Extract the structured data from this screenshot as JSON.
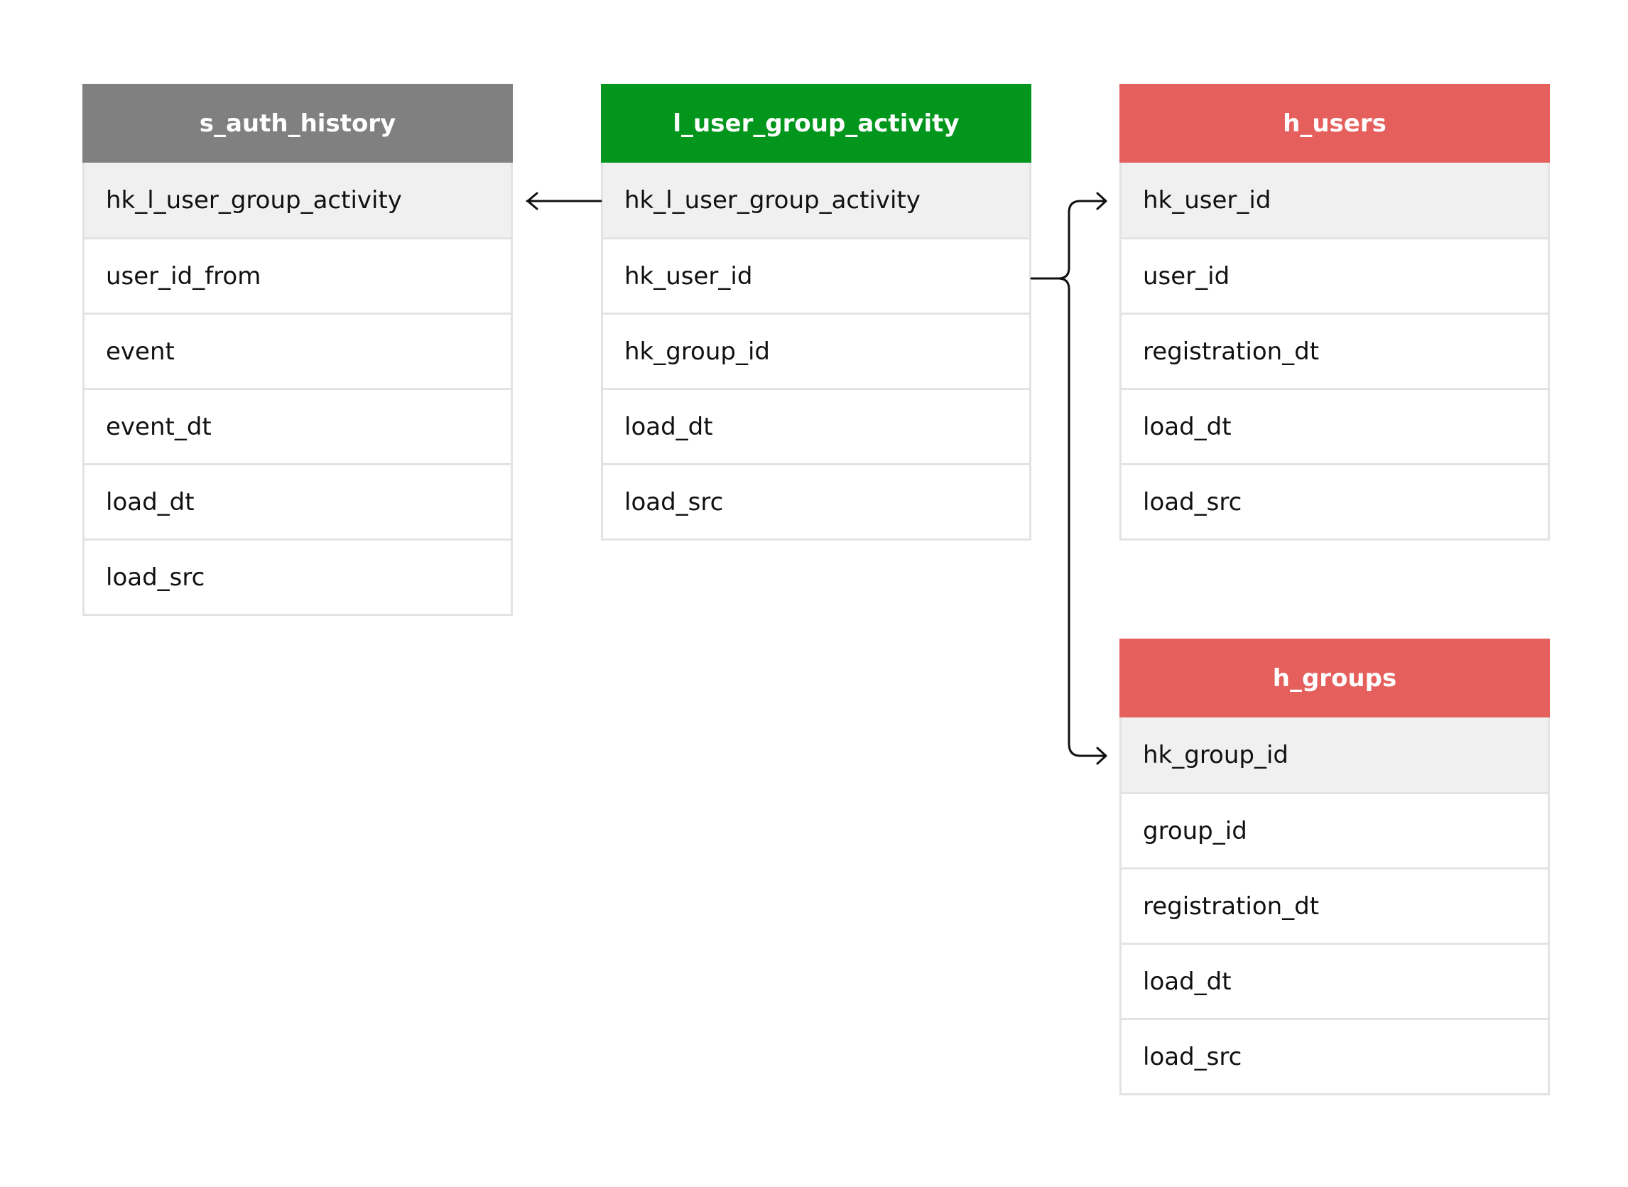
{
  "tables": [
    {
      "id": "s_auth_history",
      "title": "s_auth_history",
      "header_color": "#808080",
      "fields": [
        "hk_l_user_group_activity",
        "user_id_from",
        "event",
        "event_dt",
        "load_dt",
        "load_src"
      ]
    },
    {
      "id": "l_user_group_activity",
      "title": "l_user_group_activity",
      "header_color": "#02961c",
      "fields": [
        "hk_l_user_group_activity",
        "hk_user_id",
        "hk_group_id",
        "load_dt",
        "load_src"
      ]
    },
    {
      "id": "h_users",
      "title": "h_users",
      "header_color": "#e5605d",
      "fields": [
        "hk_user_id",
        "user_id",
        "registration_dt",
        "load_dt",
        "load_src"
      ]
    },
    {
      "id": "h_groups",
      "title": "h_groups",
      "header_color": "#e5605d",
      "fields": [
        "hk_group_id",
        "group_id",
        "registration_dt",
        "load_dt",
        "load_src"
      ]
    }
  ],
  "relations": [
    {
      "from": "l_user_group_activity.hk_l_user_group_activity",
      "to": "s_auth_history.hk_l_user_group_activity"
    },
    {
      "from": "l_user_group_activity.hk_user_id",
      "to": "h_users.hk_user_id"
    },
    {
      "from": "l_user_group_activity.hk_user_id",
      "to": "h_groups.hk_group_id"
    }
  ]
}
